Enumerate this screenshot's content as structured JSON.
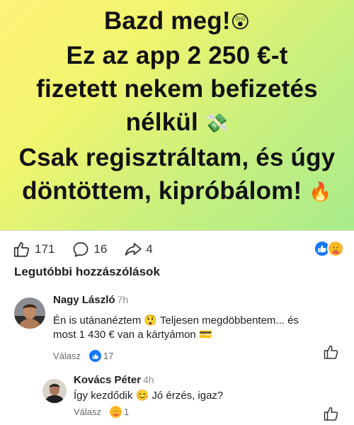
{
  "post": {
    "lines": [
      "Bazd meg!",
      "Ez az app 2 250 €-t",
      "fizetett nekem befizetés",
      "nélkül",
      "Csak regisztráltam, és úgy",
      "döntöttem, kipróbálom!"
    ],
    "emojis": {
      "astonished": "😲",
      "money_wings": "💸",
      "fire": "🔥"
    },
    "gradient_colors": [
      "#fff27a",
      "#cdf07c",
      "#a8ec8c"
    ]
  },
  "actions": {
    "likes": "171",
    "comments": "16",
    "shares": "4"
  },
  "section_title": "Legutóbbi hozzászólások",
  "comments": [
    {
      "name": "Nagy László",
      "time": "7h",
      "text_line1": "Én is utánanéztem 😲 Teljesen megdöbbentem... és",
      "text_line2": "most 1 430 € van a kártyámon 💳",
      "reply_label": "Válasz",
      "reaction_count": "17",
      "reaction_type": "like"
    },
    {
      "name": "Kovács Péter",
      "time": "4h",
      "text": "Így kezdődik 😊 Jó érzés, igaz?",
      "reply_label": "Válasz",
      "reaction_count": "1",
      "reaction_type": "care"
    }
  ],
  "colors": {
    "facebook_blue": "#1877f2",
    "care_yellow": "#f7b928",
    "muted_text": "#65676b"
  }
}
